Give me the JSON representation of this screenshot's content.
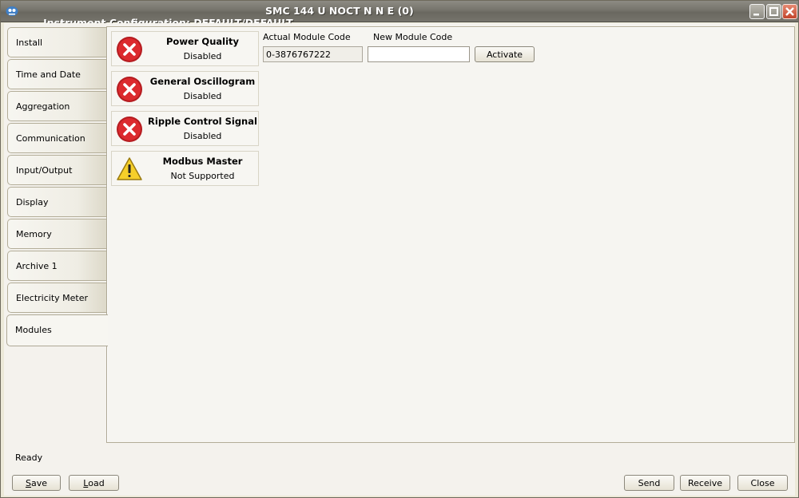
{
  "window": {
    "title": "Instrument Configuration: DEFAULT/DEFAULT",
    "model": "SMC 144 U NOCT N N E (0)"
  },
  "tabs": [
    {
      "label": "Install"
    },
    {
      "label": "Time and Date"
    },
    {
      "label": "Aggregation"
    },
    {
      "label": "Communication"
    },
    {
      "label": "Input/Output"
    },
    {
      "label": "Display"
    },
    {
      "label": "Memory"
    },
    {
      "label": "Archive 1"
    },
    {
      "label": "Electricity Meter"
    },
    {
      "label": "Modules"
    }
  ],
  "active_tab": "Modules",
  "modules": [
    {
      "title": "Power Quality",
      "status": "Disabled",
      "icon": "error-icon"
    },
    {
      "title": "General Oscillogram",
      "status": "Disabled",
      "icon": "error-icon"
    },
    {
      "title": "Ripple Control Signal",
      "status": "Disabled",
      "icon": "error-icon"
    },
    {
      "title": "Modbus Master",
      "status": "Not Supported",
      "icon": "warning-icon"
    }
  ],
  "module_code": {
    "actual_label": "Actual Module Code",
    "actual_value": "0-3876767222",
    "new_label": "New Module Code",
    "new_value": "",
    "activate_label": "Activate"
  },
  "status_text": "Ready",
  "footer": {
    "save_first": "S",
    "save_rest": "ave",
    "load_first": "L",
    "load_rest": "oad",
    "send_label": "Send",
    "receive_label": "Receive",
    "close_label": "Close"
  },
  "colors": {
    "titlebar": "#76746c",
    "window_bg": "#ece9d8",
    "error_red": "#d9252a",
    "warning_yellow": "#f6cf2a"
  }
}
